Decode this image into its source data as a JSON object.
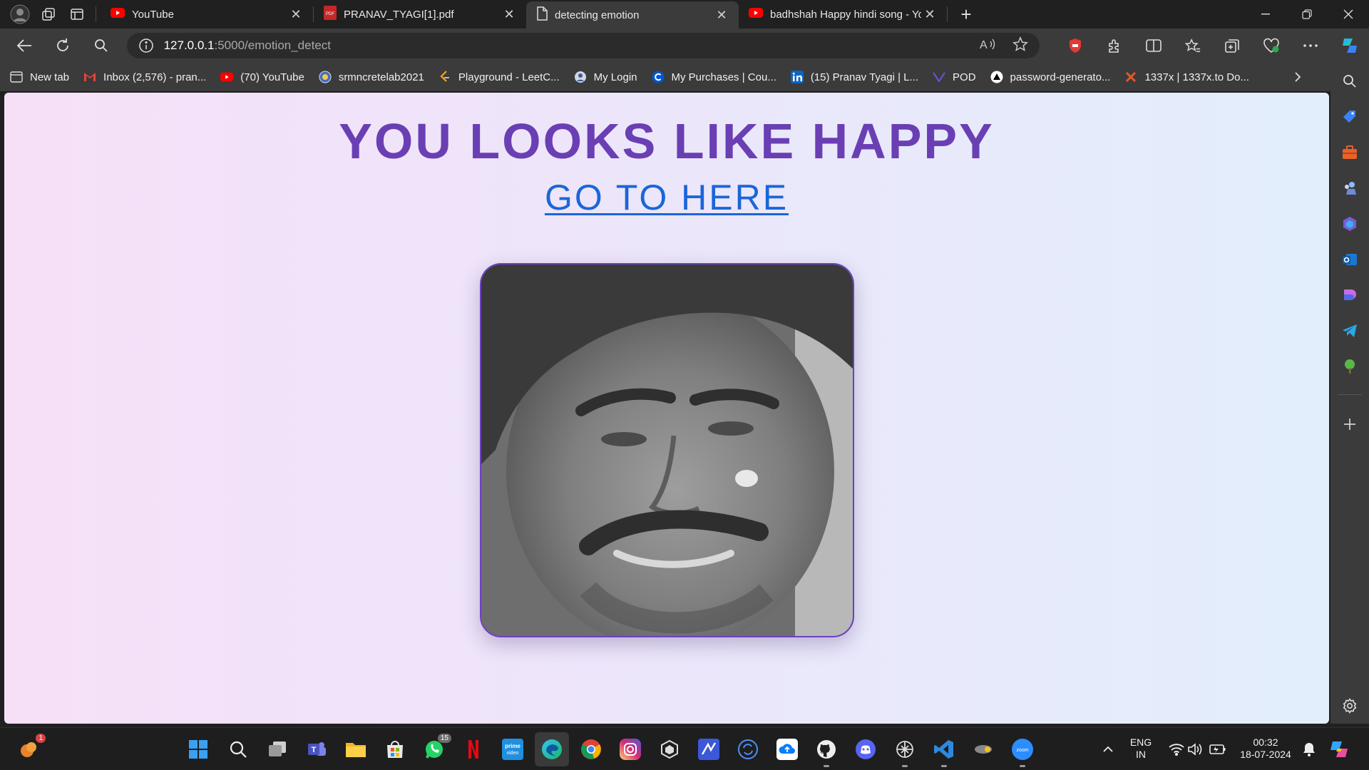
{
  "browser": {
    "tabs": [
      {
        "title": "YouTube",
        "icon": "youtube-icon",
        "active": false
      },
      {
        "title": "PRANAV_TYAGI[1].pdf",
        "icon": "pdf-icon",
        "active": false
      },
      {
        "title": "detecting emotion",
        "icon": "page-icon",
        "active": true
      },
      {
        "title": "badhshah Happy hindi song - Yo",
        "icon": "youtube-icon",
        "active": false
      }
    ],
    "close_glyph": "✕",
    "new_tab_glyph": "+",
    "address": {
      "host": "127.0.0.1",
      "path": ":5000/emotion_detect"
    },
    "favorites": [
      {
        "label": "New tab",
        "icon": "new-tab-icon"
      },
      {
        "label": "Inbox (2,576) - pran...",
        "icon": "gmail-icon"
      },
      {
        "label": "(70) YouTube",
        "icon": "youtube-icon"
      },
      {
        "label": "srmncretelab2021",
        "icon": "srm-icon"
      },
      {
        "label": "Playground - LeetC...",
        "icon": "leetcode-icon"
      },
      {
        "label": "My Login",
        "icon": "login-icon"
      },
      {
        "label": "My Purchases | Cou...",
        "icon": "coursera-icon"
      },
      {
        "label": "(15) Pranav Tyagi | L...",
        "icon": "linkedin-icon"
      },
      {
        "label": "POD",
        "icon": "pod-icon"
      },
      {
        "label": "password-generato...",
        "icon": "vercel-icon"
      },
      {
        "label": "1337x | 1337x.to Do...",
        "icon": "1337x-icon"
      }
    ]
  },
  "page": {
    "headline": "YOU LOOKS LIKE HAPPY",
    "link_text": "GO TO HERE"
  },
  "taskbar": {
    "whatsapp_badge": "15",
    "notification_badge": "1",
    "lang_line1": "ENG",
    "lang_line2": "IN",
    "time": "00:32",
    "date": "18-07-2024"
  },
  "colors": {
    "headline": "#6a3fb3",
    "link": "#1a66d8",
    "photo_border": "#6b40c4"
  }
}
